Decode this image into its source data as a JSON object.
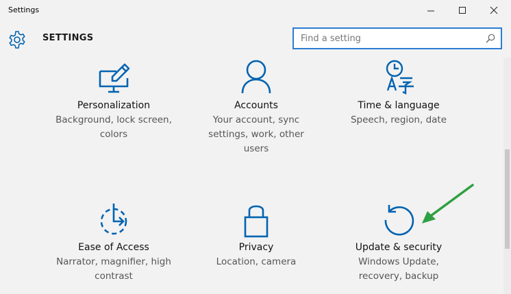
{
  "window": {
    "title": "Settings"
  },
  "header": {
    "heading": "SETTINGS"
  },
  "search": {
    "placeholder": "Find a setting",
    "value": ""
  },
  "tiles": [
    {
      "name": "Personalization",
      "description": "Background, lock screen, colors",
      "icon": "personalization-icon"
    },
    {
      "name": "Accounts",
      "description": "Your account, sync settings, work, other users",
      "icon": "person-icon"
    },
    {
      "name": "Time & language",
      "description": "Speech, region, date",
      "icon": "time-language-icon"
    },
    {
      "name": "Ease of Access",
      "description": "Narrator, magnifier, high contrast",
      "icon": "ease-of-access-icon"
    },
    {
      "name": "Privacy",
      "description": "Location, camera",
      "icon": "lock-icon"
    },
    {
      "name": "Update & security",
      "description": "Windows Update, recovery, backup",
      "icon": "refresh-icon"
    }
  ],
  "colors": {
    "accent": "#0063b1",
    "annotation_arrow": "#2ea043"
  }
}
